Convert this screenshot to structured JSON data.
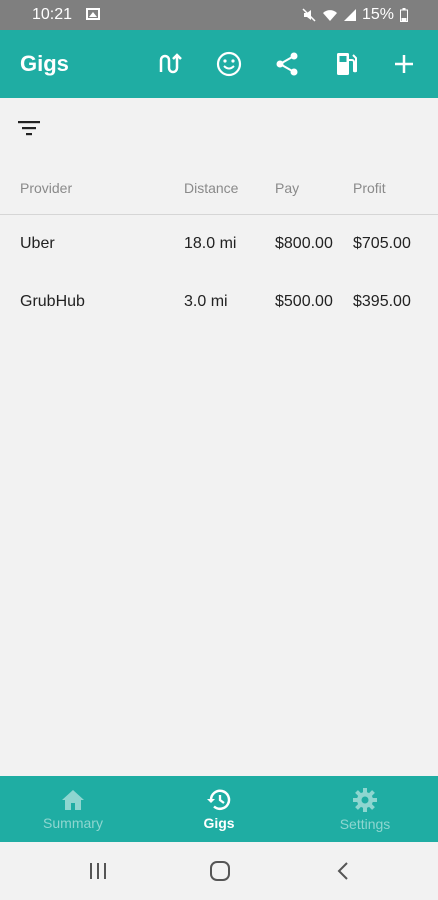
{
  "status_bar": {
    "time": "10:21",
    "battery_percent": "15%"
  },
  "app_bar": {
    "title": "Gigs",
    "actions": [
      "routes-icon",
      "smiley-icon",
      "share-icon",
      "fuel-pump-icon",
      "add-icon"
    ]
  },
  "table": {
    "columns": [
      "Provider",
      "Distance",
      "Pay",
      "Profit"
    ],
    "rows": [
      {
        "provider": "Uber",
        "distance": "18.0 mi",
        "pay": "$800.00",
        "profit": "$705.00"
      },
      {
        "provider": "GrubHub",
        "distance": "3.0 mi",
        "pay": "$500.00",
        "profit": "$395.00"
      }
    ]
  },
  "bottom_nav": {
    "items": [
      {
        "label": "Summary",
        "icon": "home-icon",
        "active": false
      },
      {
        "label": "Gigs",
        "icon": "history-icon",
        "active": true
      },
      {
        "label": "Settings",
        "icon": "gear-icon",
        "active": false
      }
    ]
  },
  "colors": {
    "primary": "#1fada3",
    "status_bar": "#7f7f7f",
    "background": "#f2f2f2"
  }
}
